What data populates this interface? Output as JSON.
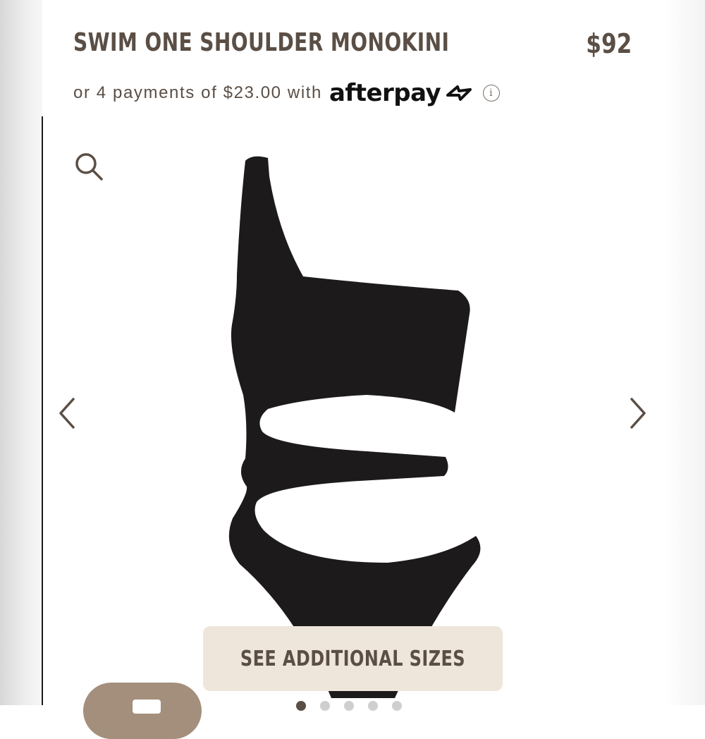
{
  "product": {
    "title": "SWIM ONE SHOULDER MONOKINI",
    "price": "$92"
  },
  "afterpay": {
    "text": "or 4 payments of $23.00 with",
    "logo": "afterpay",
    "logo_icon": "afterpay-arrows-icon",
    "info_icon": "info-icon",
    "info_glyph": "i"
  },
  "gallery": {
    "zoom_icon": "search-icon",
    "prev_icon": "chevron-left-icon",
    "next_icon": "chevron-right-icon",
    "image_color": "#1c1a1a",
    "dots_count": 5,
    "active_dot": 1
  },
  "actions": {
    "see_sizes": "SEE ADDITIONAL SIZES"
  },
  "colors": {
    "text_brown": "#5a4e45",
    "button_bg": "#efe6db",
    "chat_bg": "#a38f7c"
  }
}
